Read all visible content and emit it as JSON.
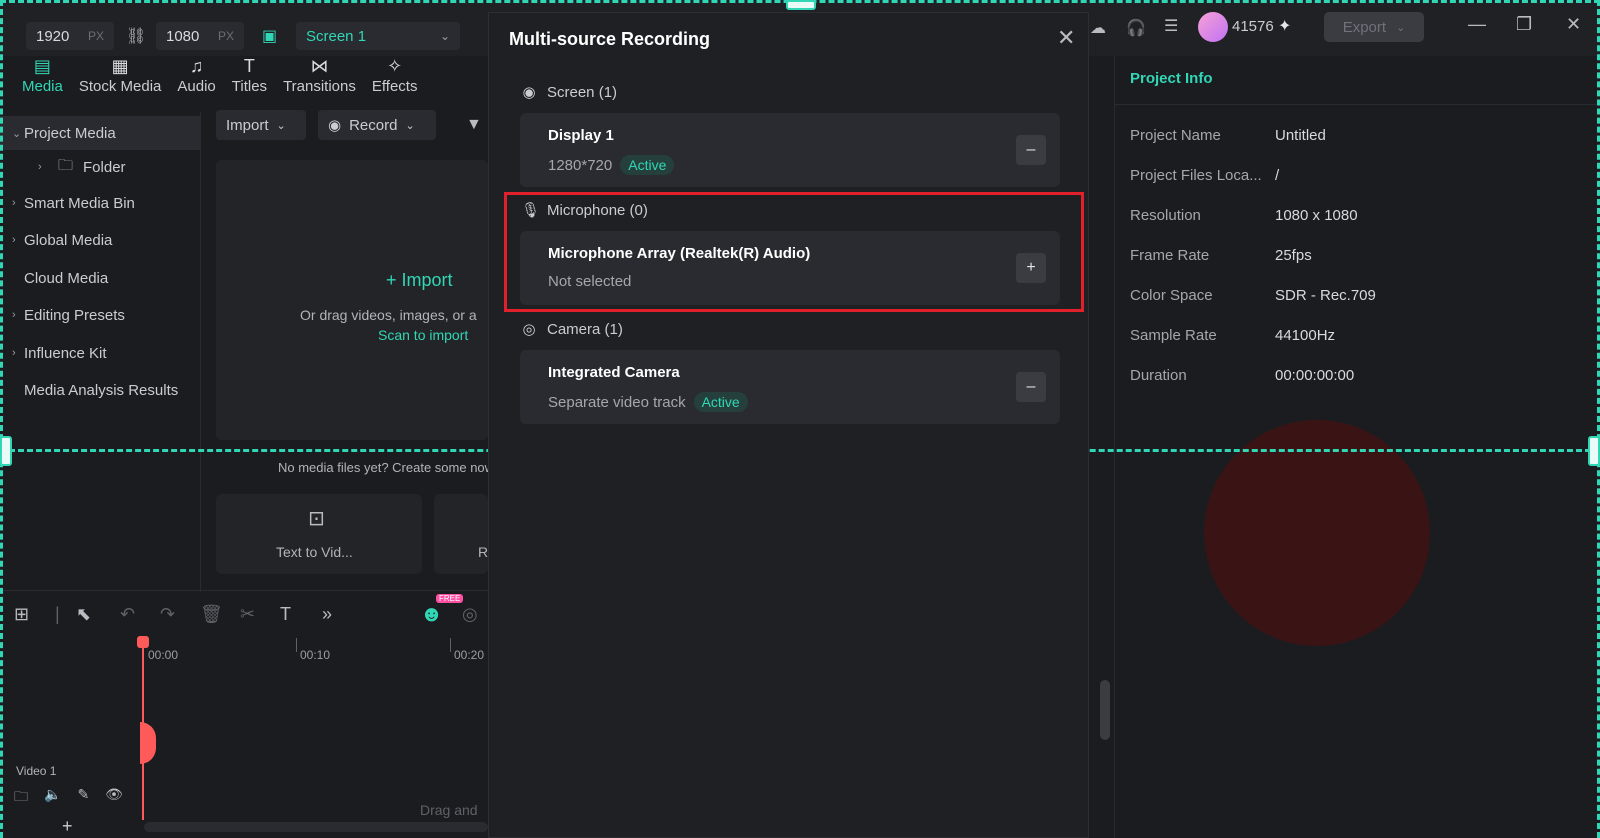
{
  "topbar": {
    "width_value": "1920",
    "height_value": "1080",
    "px_unit": "PX",
    "screen_select": "Screen 1",
    "credits": "41576",
    "export_label": "Export"
  },
  "media_tabs": [
    {
      "label": "Media",
      "icon": "media-icon"
    },
    {
      "label": "Stock Media",
      "icon": "stock-media-icon"
    },
    {
      "label": "Audio",
      "icon": "music-note-icon"
    },
    {
      "label": "Titles",
      "icon": "text-icon"
    },
    {
      "label": "Transitions",
      "icon": "transition-icon"
    },
    {
      "label": "Effects",
      "icon": "effects-icon"
    }
  ],
  "sidebar": {
    "items": [
      {
        "label": "Project Media"
      },
      {
        "label": "Folder"
      },
      {
        "label": "Smart Media Bin"
      },
      {
        "label": "Global Media"
      },
      {
        "label": "Cloud Media"
      },
      {
        "label": "Editing Presets"
      },
      {
        "label": "Influence Kit"
      },
      {
        "label": "Media Analysis Results"
      }
    ]
  },
  "media_panel": {
    "import_btn": "Import",
    "record_btn": "Record",
    "import_big": "Import",
    "drag_hint": "Or drag videos, images, or a",
    "scan_link": "Scan to import",
    "no_media": "No media files yet? Create some now",
    "card_text_to_video": "Text to Vid...",
    "card_partial": "R"
  },
  "timeline": {
    "ruler": [
      "00:00",
      "00:10",
      "00:20"
    ],
    "track_label": "Video 1",
    "drag_hint": "Drag and",
    "free_badge": "FREE"
  },
  "project_info": {
    "title": "Project Info",
    "rows": [
      {
        "label": "Project Name",
        "value": "Untitled"
      },
      {
        "label": "Project Files Loca...",
        "value": "/"
      },
      {
        "label": "Resolution",
        "value": "1080 x 1080"
      },
      {
        "label": "Frame Rate",
        "value": "25fps"
      },
      {
        "label": "Color Space",
        "value": "SDR - Rec.709"
      },
      {
        "label": "Sample Rate",
        "value": "44100Hz"
      },
      {
        "label": "Duration",
        "value": "00:00:00:00"
      }
    ]
  },
  "modal": {
    "title": "Multi-source Recording",
    "screen_section": "Screen (1)",
    "display_name": "Display 1",
    "display_res": "1280*720",
    "display_status": "Active",
    "mic_section": "Microphone (0)",
    "mic_name": "Microphone Array (Realtek(R) Audio)",
    "mic_status": "Not selected",
    "camera_section": "Camera (1)",
    "camera_name": "Integrated Camera",
    "camera_sub": "Separate video track",
    "camera_status": "Active",
    "minus": "–",
    "plus": "+"
  },
  "colors": {
    "accent": "#31d6b5",
    "highlight_red": "#e0202a",
    "background": "#1b1c1f"
  }
}
